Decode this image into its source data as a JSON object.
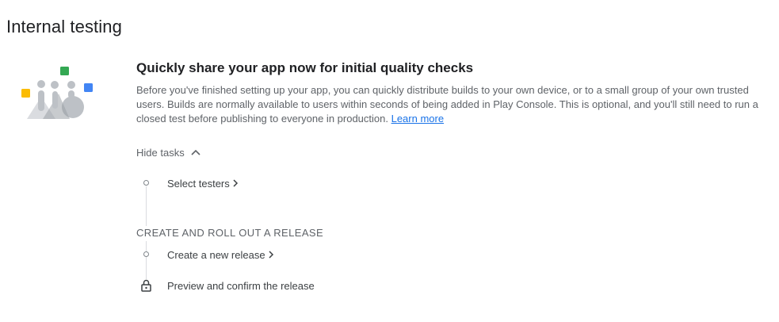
{
  "page": {
    "title": "Internal testing"
  },
  "card": {
    "title": "Quickly share your app now for initial quality checks",
    "description": "Before you've finished setting up your app, you can quickly distribute builds to your own device, or to a small group of your own trusted users. Builds are normally available to users within seconds of being added in Play Console. This is optional, and you'll still need to run a closed test before publishing to everyone in production.",
    "learn_more_label": "Learn more",
    "illustration_icon": "shapes-illustration",
    "illustration_colors": {
      "yellow": "#fbbc04",
      "green": "#34a853",
      "blue": "#4285f4",
      "gray": "#bdc1c6",
      "light_gray": "#dadce0"
    }
  },
  "toggle": {
    "label": "Hide tasks",
    "icon": "chevron-up-icon"
  },
  "tasks": {
    "select_testers": {
      "label": "Select testers",
      "status_icon": "circle-icon",
      "arrow_icon": "chevron-right-icon"
    },
    "section_heading": "CREATE AND ROLL OUT A RELEASE",
    "create_release": {
      "label": "Create a new release",
      "status_icon": "circle-icon",
      "arrow_icon": "chevron-right-icon"
    },
    "preview_release": {
      "label": "Preview and confirm the release",
      "status_icon": "lock-icon"
    }
  },
  "colors": {
    "link": "#1a73e8",
    "secondary_text": "#5f6368",
    "timeline": "#dadce0"
  }
}
